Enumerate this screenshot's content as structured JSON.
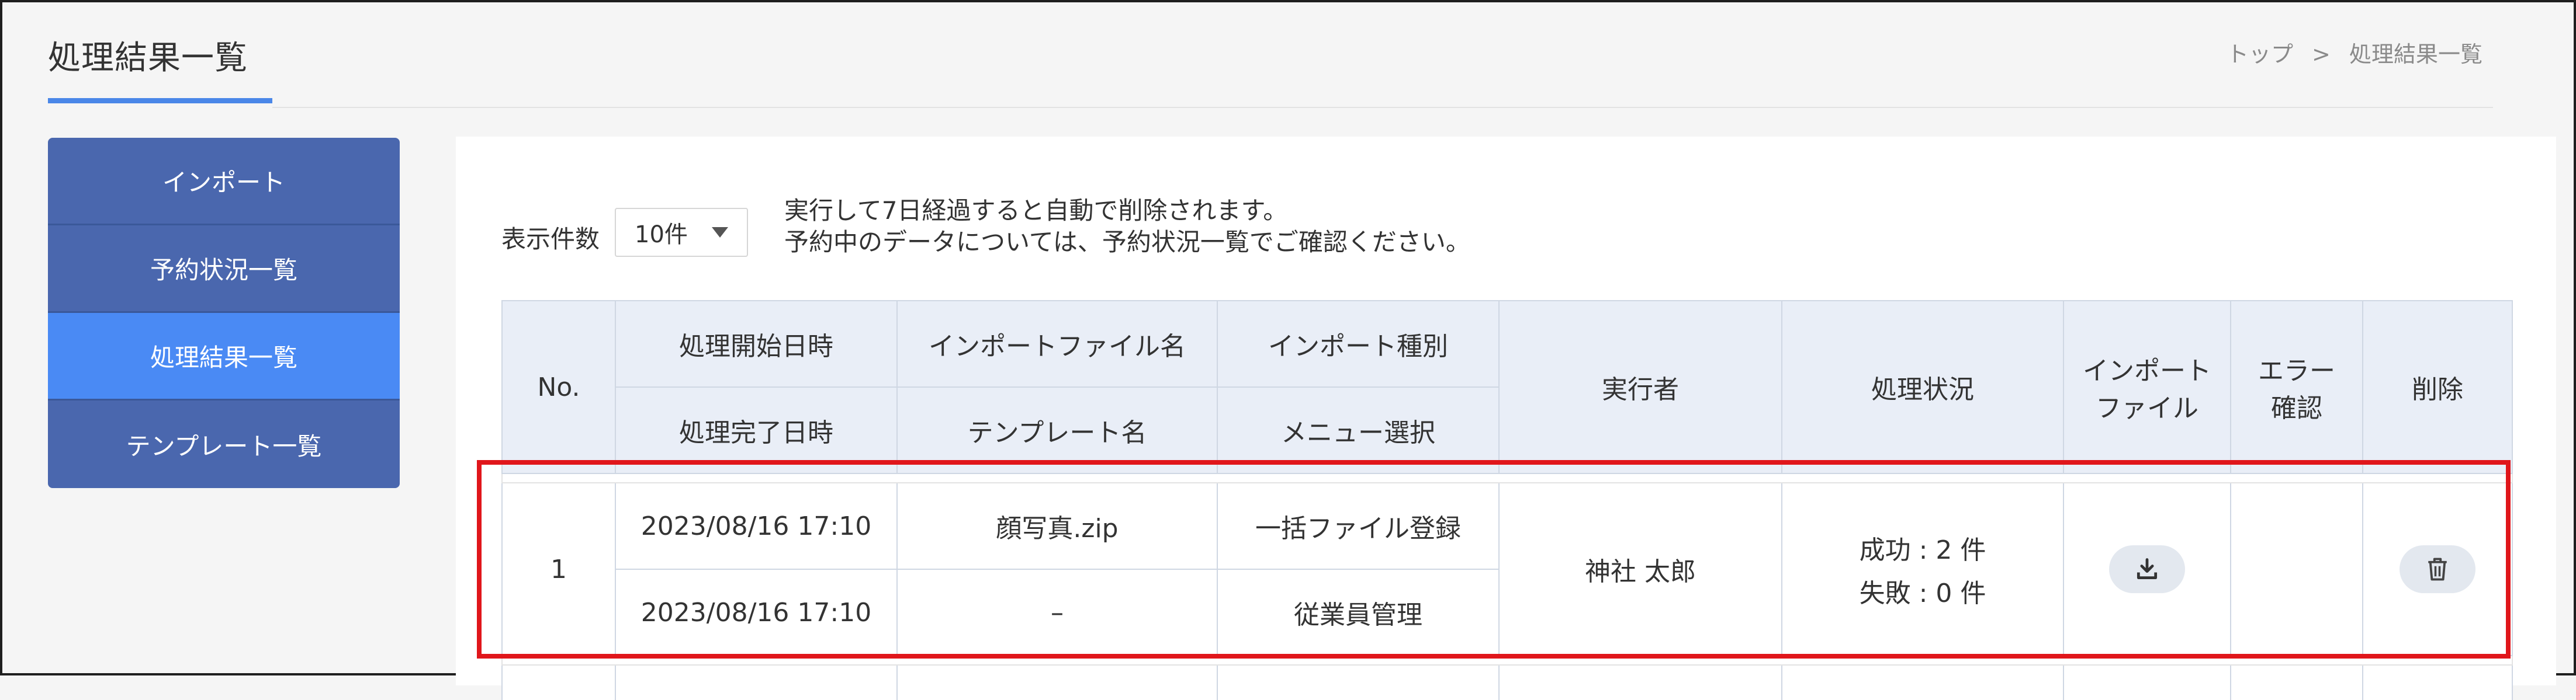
{
  "page": {
    "title": "処理結果一覧",
    "breadcrumb": {
      "home": "トップ",
      "separator": ">",
      "current": "処理結果一覧"
    }
  },
  "sidebar": {
    "items": [
      {
        "label": "インポート",
        "active": false
      },
      {
        "label": "予約状況一覧",
        "active": false
      },
      {
        "label": "処理結果一覧",
        "active": true
      },
      {
        "label": "テンプレート一覧",
        "active": false
      }
    ]
  },
  "controls": {
    "count_label": "表示件数",
    "count_value": "10件",
    "note_line1": "実行して7日経過すると自動で削除されます。",
    "note_line2": "予約中のデータについては、予約状況一覧でご確認ください。"
  },
  "table": {
    "headers": {
      "no": "No.",
      "start": "処理開始日時",
      "end": "処理完了日時",
      "file": "インポートファイル名",
      "template": "テンプレート名",
      "type": "インポート種別",
      "menu": "メニュー選択",
      "executor": "実行者",
      "status": "処理状況",
      "import_file_1": "インポート",
      "import_file_2": "ファイル",
      "error_1": "エラー",
      "error_2": "確認",
      "delete": "削除"
    },
    "rows": [
      {
        "no": "1",
        "start": "2023/08/16 17:10",
        "end": "2023/08/16 17:10",
        "file": "顔写真.zip",
        "template": "–",
        "type": "一括ファイル登録",
        "menu": "従業員管理",
        "executor": "神社 太郎",
        "status_success": "成功 : 2 件",
        "status_fail": "失敗 : 0 件"
      }
    ]
  },
  "colors": {
    "accent": "#4a87e8",
    "sidebar": "#4a67ae",
    "sidebar_active": "#4a8af4",
    "highlight": "#e0161b"
  }
}
